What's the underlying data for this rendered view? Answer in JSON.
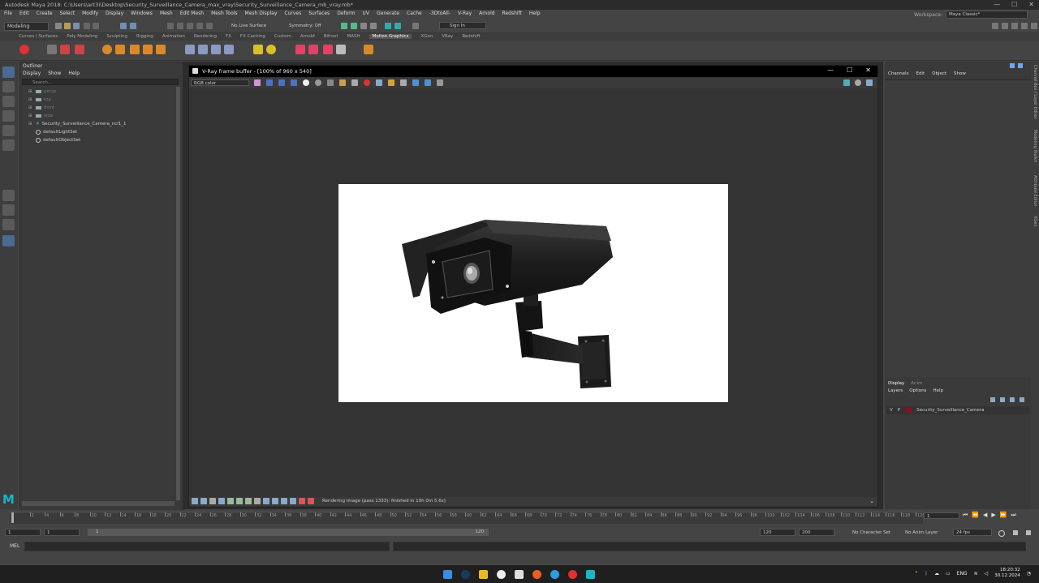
{
  "window": {
    "title": "Autodesk Maya 2018: C:\\Users\\art3i\\Desktop\\Security_Surveillance_Camera_max_vray\\Security_Surveillance_Camera_mb_vray.mb*",
    "min": "—",
    "max": "☐",
    "close": "✕"
  },
  "menu": [
    "File",
    "Edit",
    "Create",
    "Select",
    "Modify",
    "Display",
    "Windows",
    "Mesh",
    "Edit Mesh",
    "Mesh Tools",
    "Mesh Display",
    "Curves",
    "Surfaces",
    "Deform",
    "UV",
    "Generate",
    "Cache",
    "-3DtoAll-",
    "V-Ray",
    "Arnold",
    "Redshift",
    "Help"
  ],
  "workspace": {
    "label": "Workspace:",
    "value": "Maya Classic*"
  },
  "status_line": {
    "mode": "Modeling",
    "live_surface": "No Live Surface",
    "symmetry": "Symmetry: Off",
    "sign_in": "Sign In"
  },
  "shelf_tabs": [
    "Curves / Surfaces",
    "Poly Modeling",
    "Sculpting",
    "Rigging",
    "Animation",
    "Rendering",
    "FX",
    "FX Caching",
    "Custom",
    "Arnold",
    "Bifrost",
    "MASH",
    "Motion Graphics",
    "XGen",
    "VRay",
    "Redshift"
  ],
  "shelf_active": "Motion Graphics",
  "outliner": {
    "title": "Outliner",
    "menu": [
      "Display",
      "Show",
      "Help"
    ],
    "search_placeholder": "Search...",
    "items": [
      {
        "label": "persp",
        "dim": true,
        "type": "camera",
        "expand": "⊞"
      },
      {
        "label": "top",
        "dim": true,
        "type": "camera",
        "expand": "⊞"
      },
      {
        "label": "front",
        "dim": true,
        "type": "camera",
        "expand": "⊞"
      },
      {
        "label": "side",
        "dim": true,
        "type": "camera",
        "expand": "⊞"
      },
      {
        "label": "Security_Surveillance_Camera_ncl1_1",
        "dim": false,
        "type": "group",
        "expand": "⊞"
      },
      {
        "label": "defaultLightSet",
        "dim": false,
        "type": "set",
        "expand": ""
      },
      {
        "label": "defaultObjectSet",
        "dim": false,
        "type": "set",
        "expand": ""
      }
    ]
  },
  "vray": {
    "title": "V-Ray frame buffer - [100% of 960 x 540]",
    "channel": "RGB color",
    "status": "Rendering image (pass 1333): finished in 10h  0m  5.6s]",
    "min": "—",
    "max": "☐",
    "close": "✕"
  },
  "channel_box": {
    "menu": [
      "Channels",
      "Edit",
      "Object",
      "Show"
    ],
    "layer_tabs": [
      "Display",
      "Anim"
    ],
    "layer_menu": [
      "Layers",
      "Options",
      "Help"
    ],
    "layer": {
      "v": "V",
      "p": "P",
      "name": "Security_Surveillance_Camera",
      "color": "#8a1020"
    }
  },
  "side_tabs": [
    "Channel Box / Layer Editor",
    "Modeling Toolkit",
    "Attribute Editor",
    "XGen"
  ],
  "timeline": {
    "ticks": [
      "2",
      "4",
      "6",
      "8",
      "10",
      "12",
      "14",
      "16",
      "18",
      "20",
      "22",
      "24",
      "26",
      "28",
      "30",
      "32",
      "34",
      "36",
      "38",
      "40",
      "42",
      "44",
      "46",
      "48",
      "50",
      "52",
      "54",
      "56",
      "58",
      "60",
      "62",
      "64",
      "66",
      "68",
      "70",
      "72",
      "74",
      "76",
      "78",
      "80",
      "82",
      "84",
      "86",
      "88",
      "90",
      "92",
      "94",
      "96",
      "98",
      "100",
      "102",
      "104",
      "106",
      "108",
      "110",
      "112",
      "114",
      "116",
      "118",
      "120"
    ],
    "current_frame": "1",
    "play_buttons": [
      "⏮",
      "⏪",
      "◀",
      "▶",
      "⏩",
      "⏭"
    ]
  },
  "range": {
    "start": "1",
    "start2": "1",
    "slider_start": "1",
    "slider_end": "120",
    "end": "120",
    "end2": "200",
    "character_set": "No Character Set",
    "anim_layer": "No Anim Layer",
    "fps": "24 fps"
  },
  "command": {
    "label": "MEL"
  },
  "taskbar": {
    "lang": "ENG",
    "time": "18:20:32",
    "date": "30.12.2024"
  },
  "colors": {
    "accent": "#1ab6c8",
    "maya_bg": "#444444"
  }
}
